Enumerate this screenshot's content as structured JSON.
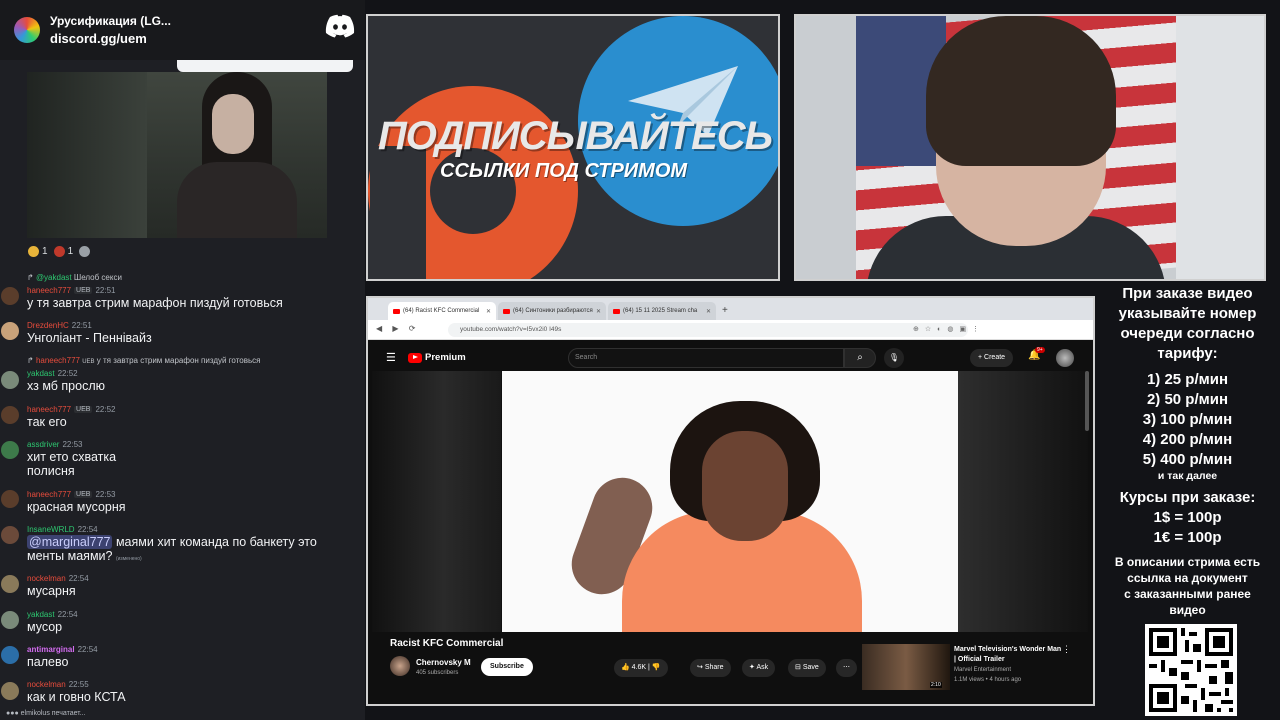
{
  "discord": {
    "server_name": "Урусификация (LG...",
    "invite": "discord.gg/uem"
  },
  "reactions": [
    {
      "emoji": "medal",
      "count": "1",
      "color": "#e8b43a"
    },
    {
      "emoji": "heart-eyes",
      "count": "1",
      "color": "#c0392b"
    },
    {
      "emoji": "coin",
      "count": "",
      "color": "#9aa0a6"
    }
  ],
  "messages": [
    {
      "reply_user": "@yakdast",
      "reply_text": "Шелоб секси",
      "user": "",
      "time": "",
      "text": ""
    },
    {
      "user": "haneech777",
      "tag": "UEB",
      "time": "22:51",
      "text": "у тя завтра стрим марафон пиздуй готовься",
      "name_color": "#e74c3c",
      "avatar": "#5a3d2b"
    },
    {
      "user": "DrezdenHC",
      "tag": "",
      "time": "22:51",
      "text": "Унголіант - Пеннівайз",
      "name_color": "#e74c3c",
      "avatar": "#c9a27a"
    },
    {
      "reply_user": "haneech777",
      "reply_tag": "UEB",
      "reply_text": "у тя завтра стрим марафон пиздуй готовься"
    },
    {
      "user": "yakdast",
      "tag": "",
      "time": "22:52",
      "text": "хз мб прослю",
      "name_color": "#2dc770",
      "avatar": "#7a8a7a"
    },
    {
      "user": "haneech777",
      "tag": "UEB",
      "time": "22:52",
      "text": "так его",
      "name_color": "#e74c3c",
      "avatar": "#5a3d2b"
    },
    {
      "user": "assdriver",
      "tag": "",
      "time": "22:53",
      "text": "хит ето схватка",
      "text2": "полисня",
      "name_color": "#2dc770",
      "avatar": "#3d7a4a"
    },
    {
      "user": "haneech777",
      "tag": "UEB",
      "time": "22:53",
      "text": "красная мусорня",
      "name_color": "#e74c3c",
      "avatar": "#5a3d2b"
    },
    {
      "user": "InsaneWRLD",
      "tag": "",
      "time": "22:54",
      "mention": "@marginal777",
      "text": " маями хит команда по банкету это",
      "text2": "менты маями?",
      "edited": "(изменено)",
      "name_color": "#2dc770",
      "avatar": "#6b4a3a"
    },
    {
      "user": "nockelman",
      "tag": "",
      "time": "22:54",
      "text": "мусарня",
      "name_color": "#e74c3c",
      "avatar": "#8a7a5a"
    },
    {
      "user": "yakdast",
      "tag": "",
      "time": "22:54",
      "text": "мусор",
      "name_color": "#2dc770",
      "avatar": "#7a8a7a"
    },
    {
      "user": "antimarginal",
      "tag": "",
      "time": "22:54",
      "text": "палево",
      "name_color": "#d36cf0",
      "avatar": "#2b6ea8"
    },
    {
      "user": "nockelman",
      "tag": "",
      "time": "22:55",
      "text": "как и говно КСТА",
      "name_color": "#e74c3c",
      "avatar": "#8a7a5a"
    }
  ],
  "typing": "elmikolus печатает...",
  "ad": {
    "title": "ПОДПИСЫВАЙТЕСЬ",
    "subtitle": "ССЫЛКИ ПОД СТРИМОМ"
  },
  "browser": {
    "tabs": [
      {
        "label": "(64) Racist KFC Commercial",
        "active": true
      },
      {
        "label": "(64) Синтоники разбираются",
        "active": false
      },
      {
        "label": "(64) 15 11 2025 Stream cha",
        "active": false
      }
    ],
    "url": "youtube.com/watch?v=I5vx2i0 I49s"
  },
  "youtube": {
    "logo": "Premium",
    "search_placeholder": "Search",
    "create": "Create",
    "notif_badge": "9+",
    "video_title": "Racist KFC Commercial",
    "channel": "Chernovsky M",
    "subs": "405 subscribers",
    "subscribe": "Subscribe",
    "likes": "4.6K",
    "share": "Share",
    "ask": "Ask",
    "save": "Save",
    "rec_title": "Marvel Television's Wonder Man | Official Trailer",
    "rec_channel": "Marvel Entertainment",
    "rec_meta": "1.1M views • 4 hours ago",
    "rec_duration": "2:10"
  },
  "info": {
    "heading": [
      "При заказе видео",
      "указывайте номер",
      "очереди согласно",
      "тарифу:"
    ],
    "tariffs": [
      "1) 25 р/мин",
      "2) 50 р/мин",
      "3) 100 р/мин",
      "4) 200 р/мин",
      "5) 400 р/мин"
    ],
    "more": "и так далее",
    "rates_title": "Курсы при заказе:",
    "rates": [
      "1$ = 100р",
      "1€ = 100р"
    ],
    "note": [
      "В описании стрима есть",
      "ссылка на документ",
      "с заказанными ранее",
      "видео"
    ]
  }
}
